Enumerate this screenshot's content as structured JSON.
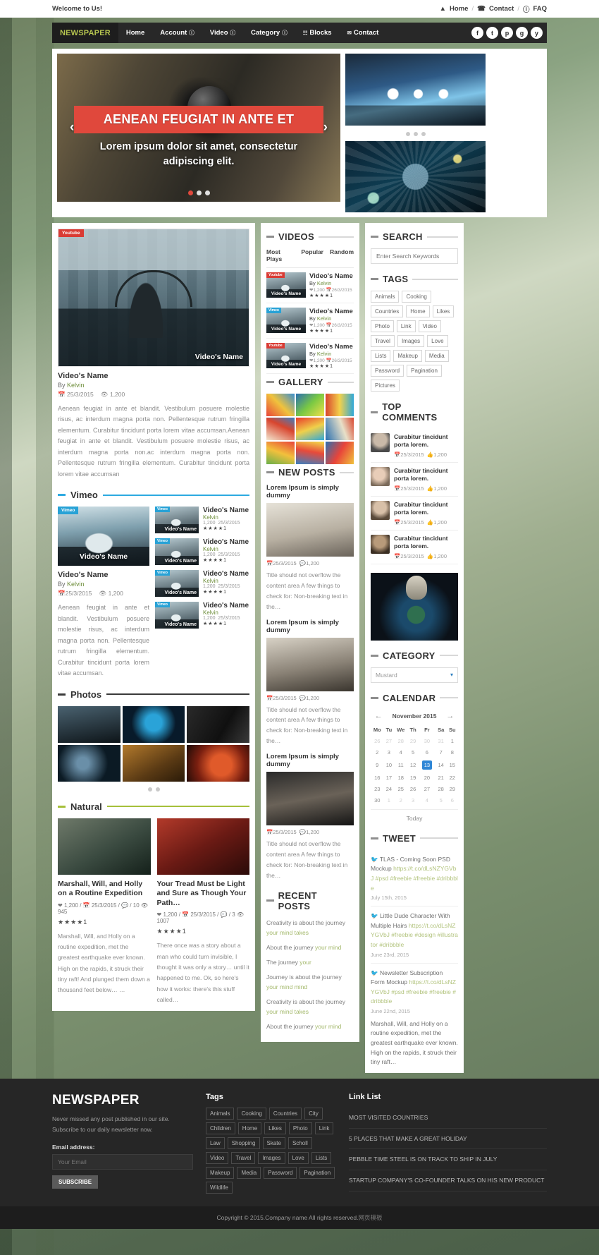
{
  "topbar": {
    "welcome": "Welcome to Us!",
    "links": [
      {
        "icon": "home-icon",
        "label": "Home"
      },
      {
        "icon": "phone-icon",
        "label": "Contact"
      },
      {
        "icon": "info-icon",
        "label": "FAQ"
      }
    ],
    "separator": "/"
  },
  "nav": {
    "brand": "NEWSPAPER",
    "items": [
      {
        "label": "Home",
        "caret": false
      },
      {
        "label": "Account",
        "caret": true
      },
      {
        "label": "Video",
        "caret": true
      },
      {
        "label": "Category",
        "caret": true
      },
      {
        "label": "Blocks",
        "caret": false,
        "icon": "blocks-icon"
      },
      {
        "label": "Contact",
        "caret": false,
        "icon": "envelope-icon"
      }
    ],
    "socials": [
      "f",
      "t",
      "p",
      "g",
      "y"
    ]
  },
  "slider": {
    "title": "AENEAN FEUGIAT IN ANTE ET",
    "subtitle": "Lorem ipsum dolor sit amet, consectetur adipiscing elit.",
    "prev": "‹",
    "next": "›"
  },
  "left": {
    "hero": {
      "badge": "Youtube",
      "overlay_name": "Video's Name",
      "title": "Video's Name",
      "by_prefix": "By ",
      "author": "Kelvin",
      "date": "25/3/2015",
      "views": "1,200",
      "body": "Aenean feugiat in ante et blandit. Vestibulum posuere molestie risus, ac interdum magna porta non. Pellentesque rutrum fringilla elementum. Curabitur tincidunt porta lorem vitae accumsan.Aenean feugiat in ante et blandit. Vestibulum posuere molestie risus, ac interdum magna porta non.ac interdum magna porta non. Pellentesque rutrum fringilla elementum. Curabitur tincidunt porta lorem vitae accumsan"
    },
    "vimeo": {
      "heading": "Vimeo",
      "accent": "#2daae1",
      "feature": {
        "badge": "Vimeo",
        "overlay_name": "Video's Name",
        "title": "Video's Name",
        "by_prefix": "By ",
        "author": "Kelvin",
        "date": "25/3/2015",
        "views": "1,200",
        "body": "Aenean feugiat in ante et blandit. Vestibulum posuere molestie risus, ac interdum magna porta non. Pellentesque rutrum fringilla elementum. Curabitur tincidunt porta lorem vitae accumsan."
      },
      "items": [
        {
          "badge": "Vimeo",
          "overlay": "Video's Name",
          "title": "Video's Name",
          "author": "Kelvin",
          "views": "1,200",
          "date": "25/3/2015",
          "stars": "★★★★",
          "half": "1"
        },
        {
          "badge": "Vimeo",
          "overlay": "Video's Name",
          "title": "Video's Name",
          "author": "Kelvin",
          "views": "1,200",
          "date": "25/3/2015",
          "stars": "★★★★",
          "half": "1"
        },
        {
          "badge": "Vimeo",
          "overlay": "Video's Name",
          "title": "Video's Name",
          "author": "Kelvin",
          "views": "1,200",
          "date": "25/3/2015",
          "stars": "★★★★",
          "half": "1"
        },
        {
          "badge": "Vimeo",
          "overlay": "Video's Name",
          "title": "Video's Name",
          "author": "Kelvin",
          "views": "1,200",
          "date": "25/3/2015",
          "stars": "★★★★",
          "half": "1"
        }
      ]
    },
    "photos": {
      "heading": "Photos",
      "accent": "#3a3a3a"
    },
    "natural": {
      "heading": "Natural",
      "accent": "#a6c03a",
      "posts": [
        {
          "title": "Marshall, Will, and Holly on a Routine Expedition",
          "likes": "1,200",
          "date": "25/3/2015",
          "comments": "10",
          "views": "945",
          "stars": "★★★★",
          "half": "1",
          "body": "Marshall, Will, and Holly on a routine expedition, met the greatest earthquake ever known. High on the rapids, it struck their tiny raft! And plunged them down a thousand feet below… …"
        },
        {
          "title": "Your Tread Must be Light and Sure as Though Your Path…",
          "likes": "1,200",
          "date": "25/3/2015",
          "comments": "3",
          "views": "1007",
          "stars": "★★★★",
          "half": "1",
          "body": "There once was a story about a man who could turn invisible, I thought it was only a story…  until it happened to me. Ok, so here's how it works: there's this stuff called…"
        }
      ]
    }
  },
  "middle": {
    "videos": {
      "heading": "VIDEOS",
      "tabs": [
        "Most Plays",
        "Popular",
        "Random"
      ],
      "items": [
        {
          "badge": "Youtube",
          "badge_color": "#d93b34",
          "overlay": "Video's Name",
          "title": "Video's Name",
          "by_prefix": "By ",
          "author": "Kelvin",
          "views": "1,200",
          "date": "26/3/2015",
          "stars": "★★★★",
          "half": "1"
        },
        {
          "badge": "Vimeo",
          "badge_color": "#28a2d6",
          "overlay": "Video's Name",
          "title": "Video's Name",
          "by_prefix": "By ",
          "author": "Kelvin",
          "views": "1,200",
          "date": "26/3/2015",
          "stars": "★★★★",
          "half": "1"
        },
        {
          "badge": "Youtube",
          "badge_color": "#d93b34",
          "overlay": "Video's Name",
          "title": "Video's Name",
          "by_prefix": "By ",
          "author": "Kelvin",
          "views": "1,200",
          "date": "26/3/2015",
          "stars": "★★★★",
          "half": "1"
        }
      ]
    },
    "gallery": {
      "heading": "GALLERY"
    },
    "new_posts": {
      "heading": "NEW POSTS",
      "posts": [
        {
          "title": "Lorem Ipsum is simply dummy",
          "date": "25/3/2015",
          "comments": "1,200",
          "body": "Title should not overflow the content area A few things to check for: Non-breaking text in the…"
        },
        {
          "title": "Lorem Ipsum is simply dummy",
          "date": "25/3/2015",
          "comments": "1,200",
          "body": "Title should not overflow the content area A few things to check for: Non-breaking text in the…"
        },
        {
          "title": "Lorem Ipsum is simply dummy",
          "date": "25/3/2015",
          "comments": "1,200",
          "body": "Title should not overflow the content area A few things to check for: Non-breaking text in the…"
        }
      ]
    },
    "recent_posts": {
      "heading": "RECENT POSTS",
      "items": [
        {
          "plain": "Creativity is about the journey ",
          "link": "your mind takes"
        },
        {
          "plain": "About the journey ",
          "link": "your mind"
        },
        {
          "plain": "The journey ",
          "link": "your"
        },
        {
          "plain": "Journey is about the journey ",
          "link": "your mind mind"
        },
        {
          "plain": "Creativity is about the journey ",
          "link": "your mind takes"
        },
        {
          "plain": "About the journey ",
          "link": "your mind"
        }
      ]
    }
  },
  "right": {
    "search": {
      "heading": "SEARCH",
      "placeholder": "Enter Search Keywords",
      "value": ""
    },
    "tags": {
      "heading": "TAGS",
      "items": [
        "Animals",
        "Cooking",
        "Countries",
        "Home",
        "Likes",
        "Photo",
        "Link",
        "Video",
        "Travel",
        "Images",
        "Love",
        "Lists",
        "Makeup",
        "Media",
        "Password",
        "Pagination",
        "Pictures"
      ]
    },
    "top_comments": {
      "heading": "TOP COMMENTS",
      "items": [
        {
          "text": "Curabitur tincidunt porta lorem.",
          "date": "25/3/2015",
          "likes": "1,200"
        },
        {
          "text": "Curabitur tincidunt porta lorem.",
          "date": "25/3/2015",
          "likes": "1,200"
        },
        {
          "text": "Curabitur tincidunt porta lorem.",
          "date": "25/3/2015",
          "likes": "1,200"
        },
        {
          "text": "Curabitur tincidunt porta lorem.",
          "date": "25/3/2015",
          "likes": "1,200"
        }
      ]
    },
    "category": {
      "heading": "CATEGORY",
      "selected": "Mustard"
    },
    "calendar": {
      "heading": "CALENDAR",
      "month": "November 2015",
      "prev": "←",
      "next": "→",
      "weekdays": [
        "Mo",
        "Tu",
        "We",
        "Th",
        "Fr",
        "Sa",
        "Su"
      ],
      "weeks": [
        [
          {
            "d": "26",
            "mut": true
          },
          {
            "d": "27",
            "mut": true
          },
          {
            "d": "28",
            "mut": true
          },
          {
            "d": "29",
            "mut": true
          },
          {
            "d": "30",
            "mut": true
          },
          {
            "d": "31",
            "mut": true
          },
          {
            "d": "1",
            "mut": false
          }
        ],
        [
          {
            "d": "2"
          },
          {
            "d": "3"
          },
          {
            "d": "4"
          },
          {
            "d": "5"
          },
          {
            "d": "6"
          },
          {
            "d": "7"
          },
          {
            "d": "8"
          }
        ],
        [
          {
            "d": "9"
          },
          {
            "d": "10"
          },
          {
            "d": "11"
          },
          {
            "d": "12"
          },
          {
            "d": "13",
            "sel": true
          },
          {
            "d": "14"
          },
          {
            "d": "15"
          }
        ],
        [
          {
            "d": "16"
          },
          {
            "d": "17"
          },
          {
            "d": "18"
          },
          {
            "d": "19"
          },
          {
            "d": "20"
          },
          {
            "d": "21"
          },
          {
            "d": "22"
          }
        ],
        [
          {
            "d": "23"
          },
          {
            "d": "24"
          },
          {
            "d": "25"
          },
          {
            "d": "26"
          },
          {
            "d": "27"
          },
          {
            "d": "28"
          },
          {
            "d": "29"
          }
        ],
        [
          {
            "d": "30"
          },
          {
            "d": "1",
            "mut": true
          },
          {
            "d": "2",
            "mut": true
          },
          {
            "d": "3",
            "mut": true
          },
          {
            "d": "4",
            "mut": true
          },
          {
            "d": "5",
            "mut": true
          },
          {
            "d": "6",
            "mut": true
          }
        ]
      ],
      "today_label": "Today"
    },
    "tweet": {
      "heading": "TWEET",
      "items": [
        {
          "text": "TLAS - Coming Soon PSD Mockup",
          "link": "https://t.co/dLsNZYGVbJ #psd #freebie #freebie #dribbble",
          "date": "July 15th, 2015"
        },
        {
          "text": "Little Dude Character With Multiple Hairs",
          "link": "https://t.co/dLsNZYGVbJ #freebie #design #illustrator #dribbble",
          "date": "June 23rd, 2015"
        },
        {
          "text": "Newsletter Subscription Form Mockup",
          "link": "https://t.co/dLsNZYGVbJ #psd #freebie #freebie #dribbble",
          "date": "June 22nd, 2015"
        }
      ],
      "footer_text": "Marshall, Will, and Holly on a routine expedition, met the greatest earthquake ever known. High on the rapids, it struck their tiny raft…"
    }
  },
  "footer": {
    "brand": "NEWSPAPER",
    "blurb": "Never missed any post published in our site. Subscribe to our daily newsletter now.",
    "email_label": "Email address:",
    "email_placeholder": "Your Email",
    "email_value": "",
    "subscribe": "SUBSCRIBE",
    "tags_heading": "Tags",
    "tags": [
      "Animals",
      "Cooking",
      "Countries",
      "City",
      "Children",
      "Home",
      "Likes",
      "Photo",
      "Link",
      "Law",
      "Shopping",
      "Skate",
      "Scholl",
      "Video",
      "Travel",
      "Images",
      "Love",
      "Lists",
      "Makeup",
      "Media",
      "Password",
      "Pagination",
      "Wildlife"
    ],
    "links_heading": "Link List",
    "links": [
      "MOST VISITED COUNTRIES",
      "5 PLACES THAT MAKE A GREAT HOLIDAY",
      "PEBBLE TIME STEEL IS ON TRACK TO SHIP IN JULY",
      "STARTUP COMPANY'S CO-FOUNDER TALKS ON HIS NEW PRODUCT"
    ]
  },
  "copyright": {
    "text": "Copyright © 2015.Company name All rights reserved.",
    "suffix": "网页模板"
  }
}
